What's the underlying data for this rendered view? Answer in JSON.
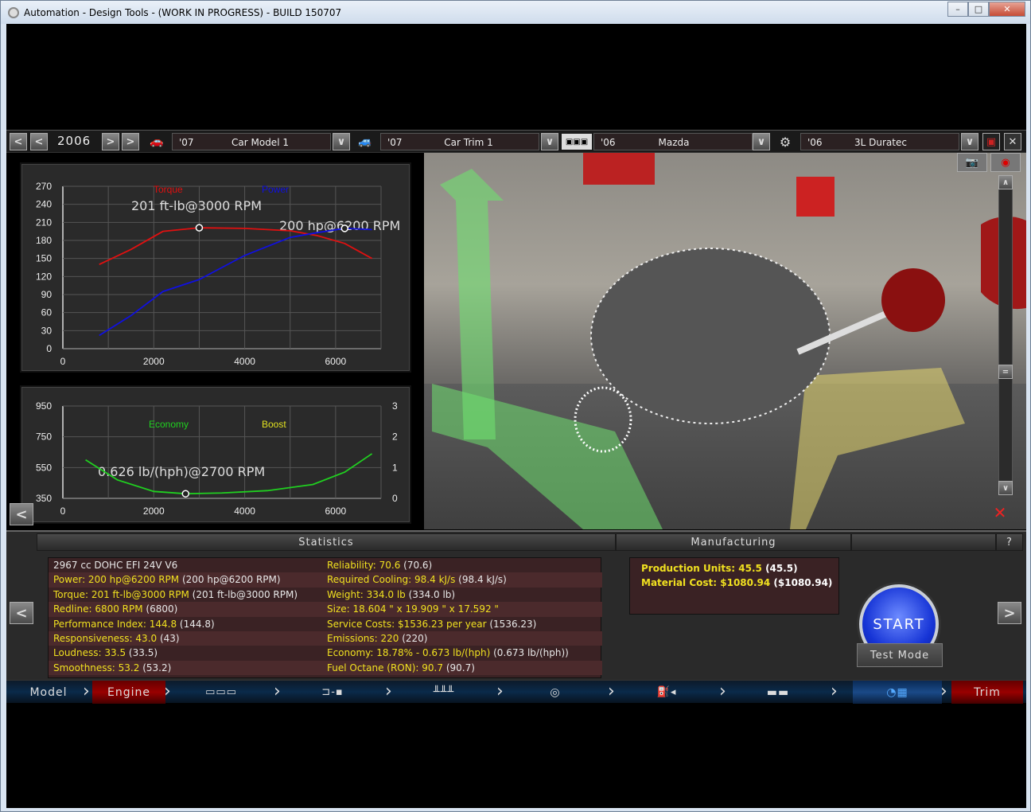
{
  "window": {
    "title": "Automation - Design Tools - (WORK IN PROGRESS) - BUILD 150707",
    "min": "–",
    "max": "□",
    "close": "✕"
  },
  "selector": {
    "year": "2006",
    "model_year": "'07",
    "model": "Car Model 1",
    "trim_year": "'07",
    "trim": "Car Trim 1",
    "family_year": "'06",
    "family": "Mazda",
    "variant_year": "'06",
    "variant": "3L Duratec",
    "prev": "<",
    "next": ">",
    "dropdown": "∨"
  },
  "torque_graph": {
    "legend_torque": "Torque",
    "legend_power": "Power",
    "torque_label": "201 ft-lb@3000 RPM",
    "power_label": "200 hp@6200 RPM",
    "yticks": [
      "270",
      "240",
      "210",
      "180",
      "150",
      "120",
      "90",
      "60",
      "30",
      "0"
    ],
    "xticks": [
      "0",
      "2000",
      "4000",
      "6000"
    ],
    "colors": {
      "torque": "#e01010",
      "power": "#1010e0"
    }
  },
  "chart_data": [
    {
      "type": "line",
      "title": "",
      "xlabel": "",
      "ylabel": "",
      "xlim": [
        0,
        7000
      ],
      "ylim": [
        0,
        270
      ],
      "x": [
        800,
        1500,
        2200,
        3000,
        4000,
        5000,
        5600,
        6200,
        6800
      ],
      "series": [
        {
          "name": "Torque",
          "values": [
            140,
            165,
            195,
            201,
            200,
            196,
            188,
            175,
            150
          ]
        },
        {
          "name": "Power",
          "values": [
            22,
            55,
            95,
            115,
            155,
            185,
            193,
            200,
            198
          ]
        }
      ]
    },
    {
      "type": "line",
      "title": "",
      "xlabel": "",
      "ylabel": "",
      "xlim": [
        0,
        7000
      ],
      "ylim": [
        350,
        950
      ],
      "y2lim": [
        0,
        3
      ],
      "x": [
        500,
        1200,
        2000,
        2700,
        3500,
        4500,
        5500,
        6200,
        6800
      ],
      "series": [
        {
          "name": "Economy",
          "values": [
            600,
            470,
            395,
            380,
            385,
            400,
            440,
            520,
            640
          ]
        },
        {
          "name": "Boost",
          "values": []
        }
      ]
    }
  ],
  "eco_graph": {
    "legend_economy": "Economy",
    "legend_boost": "Boost",
    "economy_label": "0.626 lb/(hph)@2700 RPM",
    "yticks": [
      "950",
      "750",
      "550",
      "350"
    ],
    "y2ticks": [
      "3",
      "2",
      "1",
      "0"
    ],
    "xticks": [
      "0",
      "2000",
      "4000",
      "6000"
    ],
    "colors": {
      "economy": "#20d020",
      "boost": "#e0e020"
    }
  },
  "panel": {
    "stats_title": "Statistics",
    "mfg_title": "Manufacturing",
    "help": "?",
    "start": "START",
    "test_mode": "Test Mode",
    "nav_left": "<",
    "nav_right": ">"
  },
  "stats_left": [
    {
      "label": "2967 cc DOHC EFI 24V V6",
      "value": ""
    },
    {
      "label": "Power: 200 hp@6200 RPM",
      "value": " (200 hp@6200 RPM)"
    },
    {
      "label": "Torque: 201 ft-lb@3000 RPM",
      "value": " (201 ft-lb@3000 RPM)"
    },
    {
      "label": "Redline: 6800 RPM",
      "value": " (6800)"
    },
    {
      "label": "Performance Index: 144.8",
      "value": " (144.8)"
    },
    {
      "label": "Responsiveness: 43.0",
      "value": " (43)"
    },
    {
      "label": "Loudness: 33.5",
      "value": " (33.5)"
    },
    {
      "label": "Smoothness: 53.2",
      "value": " (53.2)"
    }
  ],
  "stats_right": [
    {
      "label": "Reliability: 70.6",
      "value": " (70.6)"
    },
    {
      "label": "Required Cooling: 98.4 kJ/s",
      "value": " (98.4 kJ/s)"
    },
    {
      "label": "Weight: 334.0 lb",
      "value": " (334.0 lb)"
    },
    {
      "label": "Size: 18.604 \" x 19.909 \" x 17.592 \"",
      "value": ""
    },
    {
      "label": "Service Costs: $1536.23 per year",
      "value": " (1536.23)"
    },
    {
      "label": "Emissions: 220",
      "value": " (220)"
    },
    {
      "label": "Economy: 18.78% - 0.673 lb/(hph)",
      "value": " (0.673 lb/(hph))"
    },
    {
      "label": "Fuel Octane (RON): 90.7",
      "value": " (90.7)"
    }
  ],
  "manufacturing": {
    "units_label": "Production Units: 45.5",
    "units_value": " (45.5)",
    "cost_label": "Material Cost: $1080.94",
    "cost_value": " ($1080.94)"
  },
  "tabs": {
    "model": "Model",
    "engine": "Engine",
    "trim": "Trim"
  }
}
